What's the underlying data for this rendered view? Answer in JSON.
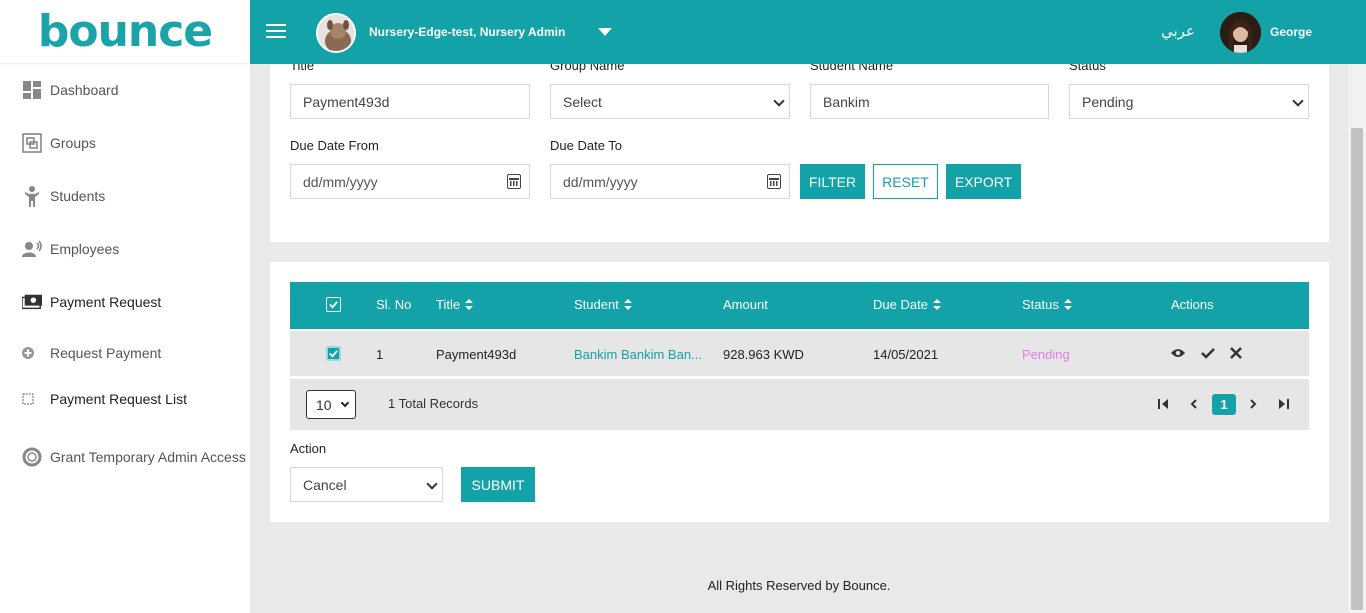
{
  "sidebar": {
    "logo": "bounce",
    "items": [
      {
        "label": "Dashboard",
        "icon": "dashboard-icon"
      },
      {
        "label": "Groups",
        "icon": "groups-icon"
      },
      {
        "label": "Students",
        "icon": "student-icon"
      },
      {
        "label": "Employees",
        "icon": "employees-icon"
      },
      {
        "label": "Payment Request",
        "icon": "payment-icon"
      },
      {
        "label": "Request Payment",
        "icon": "plus-circle-icon"
      },
      {
        "label": "Payment Request List",
        "icon": "list-square-icon"
      },
      {
        "label": "Grant Temporary Admin Access",
        "icon": "lifebuoy-icon"
      }
    ]
  },
  "header": {
    "org": "Nursery-Edge-test, Nursery Admin",
    "language": "عربي",
    "user": "George"
  },
  "filters": {
    "title_label": "Title",
    "title_value": "Payment493d",
    "group_label": "Group Name",
    "group_value": "Select",
    "student_label": "Student Name",
    "student_value": "Bankim",
    "status_label": "Status",
    "status_value": "Pending",
    "due_from_label": "Due Date From",
    "due_from_placeholder": "dd/mm/yyyy",
    "due_to_label": "Due Date To",
    "due_to_placeholder": "dd/mm/yyyy",
    "filter_btn": "FILTER",
    "reset_btn": "RESET",
    "export_btn": "EXPORT"
  },
  "table": {
    "columns": [
      "Sl. No",
      "Title",
      "Student",
      "Amount",
      "Due Date",
      "Status",
      "Actions"
    ],
    "rows": [
      {
        "sl": "1",
        "title": "Payment493d",
        "student": "Bankim Bankim Ban...",
        "amount": "928.963 KWD",
        "due": "14/05/2021",
        "status": "Pending"
      }
    ],
    "page_size": "10",
    "total_records": "1 Total Records",
    "current_page": "1"
  },
  "bulk": {
    "action_label": "Action",
    "action_value": "Cancel",
    "submit_btn": "SUBMIT"
  },
  "footer": "All Rights Reserved by Bounce.",
  "colors": {
    "accent": "#12a2a8",
    "pending": "#e07de6"
  }
}
